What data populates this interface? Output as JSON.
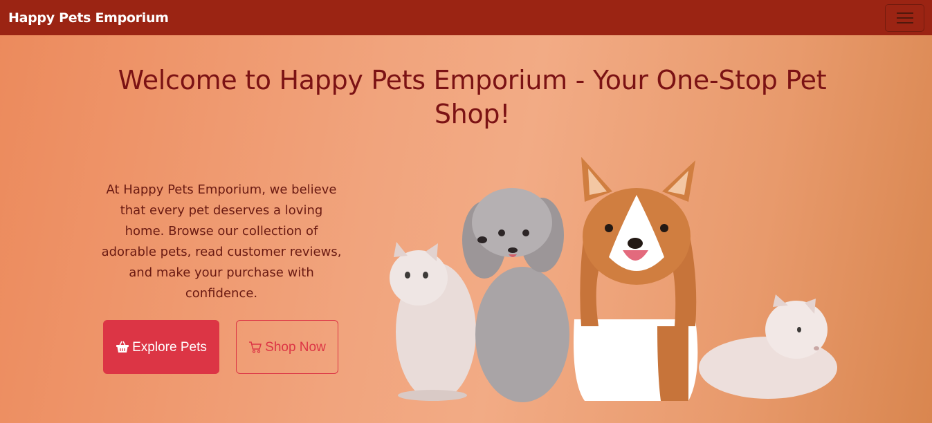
{
  "navbar": {
    "brand": "Happy Pets Emporium",
    "toggler_icon": "hamburger-menu-icon"
  },
  "hero": {
    "title": "Welcome to Happy Pets Emporium - Your One-Stop Pet Shop!",
    "description": "At Happy Pets Emporium, we believe that every pet deserves a loving home. Browse our collection of adorable pets, read customer reviews, and make your purchase with confidence.",
    "buttons": {
      "explore": {
        "label": "Explore Pets",
        "icon": "basket-icon"
      },
      "shop": {
        "label": "Shop Now",
        "icon": "cart-icon"
      }
    }
  },
  "colors": {
    "navbar_bg": "#9b2413",
    "title": "#7b1214",
    "button_primary": "#dc3545"
  }
}
